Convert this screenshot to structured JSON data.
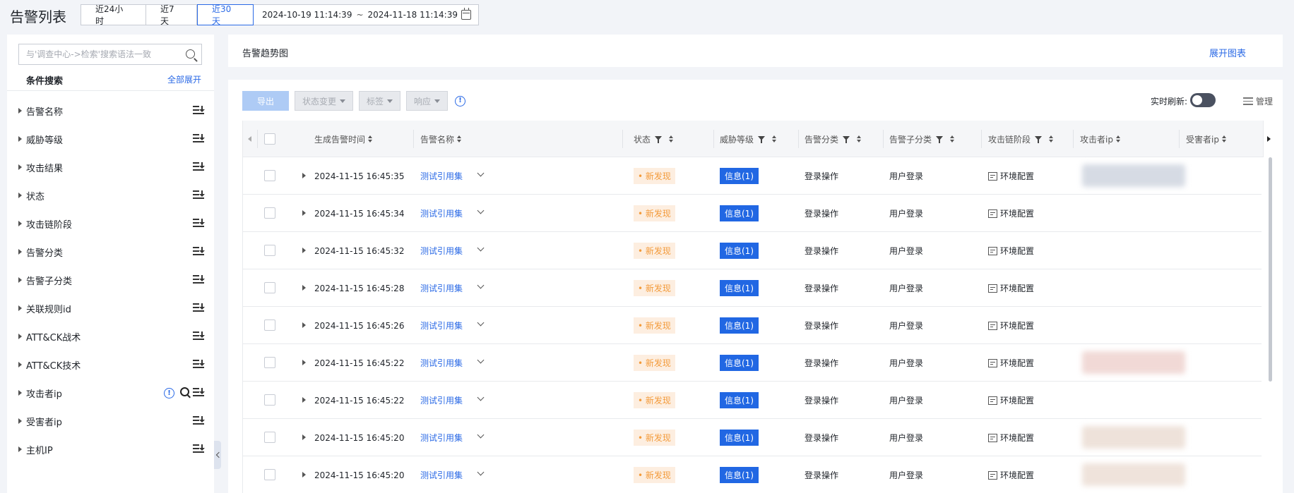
{
  "header": {
    "title": "告警列表",
    "ranges": [
      "近24小时",
      "近7天",
      "近30天"
    ],
    "active_range": "近30天",
    "date_start": "2024-10-19 11:14:39",
    "date_sep": "~",
    "date_end": "2024-11-18 11:14:39",
    "calendar_icon": "calendar-icon"
  },
  "sidebar": {
    "search_placeholder": "与'调查中心->检索'搜索语法一致",
    "cond_title": "条件搜索",
    "expand_all": "全部展开",
    "filters": [
      {
        "label": "告警名称"
      },
      {
        "label": "威胁等级"
      },
      {
        "label": "攻击结果"
      },
      {
        "label": "状态"
      },
      {
        "label": "攻击链阶段"
      },
      {
        "label": "告警分类"
      },
      {
        "label": "告警子分类"
      },
      {
        "label": "关联规则id"
      },
      {
        "label": "ATT&CK战术"
      },
      {
        "label": "ATT&CK技术"
      },
      {
        "label": "攻击者ip"
      },
      {
        "label": "受害者ip"
      },
      {
        "label": "主机IP"
      }
    ]
  },
  "trend": {
    "title": "告警趋势图",
    "expand": "展开图表"
  },
  "toolbar": {
    "export": "导出",
    "status_change": "状态变更",
    "tag": "标签",
    "response": "响应",
    "realtime_label": "实时刷新:",
    "realtime_on": false,
    "manage": "管理"
  },
  "table": {
    "columns": {
      "time": "生成告警时间",
      "name": "告警名称",
      "status": "状态",
      "level": "威胁等级",
      "category": "告警分类",
      "subcategory": "告警子分类",
      "stage": "攻击链阶段",
      "attacker_ip": "攻击者ip",
      "victim_ip": "受害者ip"
    },
    "rows": [
      {
        "time": "2024-11-15 16:45:35",
        "name": "测试引用集",
        "status": "• 新发现",
        "level": "信息(1)",
        "category": "登录操作",
        "subcategory": "用户登录",
        "stage": "环境配置",
        "ip_blur": "#d6dbe4"
      },
      {
        "time": "2024-11-15 16:45:34",
        "name": "测试引用集",
        "status": "• 新发现",
        "level": "信息(1)",
        "category": "登录操作",
        "subcategory": "用户登录",
        "stage": "环境配置",
        "ip_blur": ""
      },
      {
        "time": "2024-11-15 16:45:32",
        "name": "测试引用集",
        "status": "• 新发现",
        "level": "信息(1)",
        "category": "登录操作",
        "subcategory": "用户登录",
        "stage": "环境配置",
        "ip_blur": ""
      },
      {
        "time": "2024-11-15 16:45:28",
        "name": "测试引用集",
        "status": "• 新发现",
        "level": "信息(1)",
        "category": "登录操作",
        "subcategory": "用户登录",
        "stage": "环境配置",
        "ip_blur": ""
      },
      {
        "time": "2024-11-15 16:45:26",
        "name": "测试引用集",
        "status": "• 新发现",
        "level": "信息(1)",
        "category": "登录操作",
        "subcategory": "用户登录",
        "stage": "环境配置",
        "ip_blur": ""
      },
      {
        "time": "2024-11-15 16:45:22",
        "name": "测试引用集",
        "status": "• 新发现",
        "level": "信息(1)",
        "category": "登录操作",
        "subcategory": "用户登录",
        "stage": "环境配置",
        "ip_blur": "#f1d9d6"
      },
      {
        "time": "2024-11-15 16:45:22",
        "name": "测试引用集",
        "status": "• 新发现",
        "level": "信息(1)",
        "category": "登录操作",
        "subcategory": "用户登录",
        "stage": "环境配置",
        "ip_blur": ""
      },
      {
        "time": "2024-11-15 16:45:20",
        "name": "测试引用集",
        "status": "• 新发现",
        "level": "信息(1)",
        "category": "登录操作",
        "subcategory": "用户登录",
        "stage": "环境配置",
        "ip_blur": "#eee2da"
      },
      {
        "time": "2024-11-15 16:45:20",
        "name": "测试引用集",
        "status": "• 新发现",
        "level": "信息(1)",
        "category": "登录操作",
        "subcategory": "用户登录",
        "stage": "环境配置",
        "ip_blur": "#efe3db"
      }
    ]
  },
  "colors": {
    "accent": "#2b6ae6",
    "status_bg": "#fdeee0",
    "status_fg": "#f39b3b",
    "level_bg": "#2167e3"
  }
}
